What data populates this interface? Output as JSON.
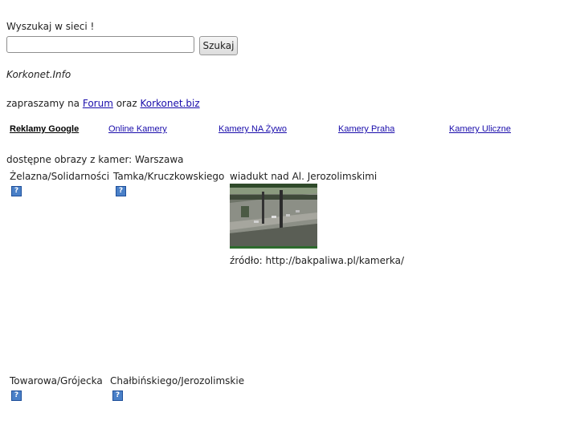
{
  "search": {
    "label": "Wyszukaj w sieci !",
    "input_value": "",
    "button_label": "Szukaj"
  },
  "brand": "Korkonet.Info",
  "invite": {
    "prefix": "zapraszamy na ",
    "forum_link": "Forum",
    "middle": " oraz ",
    "site_link": "Korkonet.biz"
  },
  "ad_links": {
    "header": "Reklamy Google",
    "items": [
      "Online Kamery",
      "Kamery NA Żywo",
      "Kamery Praha",
      "Kamery Uliczne"
    ]
  },
  "cameras": {
    "intro": "dostępne obrazy z kamer: Warszawa",
    "items": [
      {
        "name": "Żelazna/Solidarności"
      },
      {
        "name": "Tamka/Kruczkowskiego"
      },
      {
        "name": "wiadukt nad Al. Jerozolimskimi",
        "source": "źródło: http://bakpaliwa.pl/kamerka/"
      },
      {
        "name": "Towarowa/Grójecka"
      },
      {
        "name": "Chałbińskiego/Jerozolimskie"
      }
    ]
  },
  "icons": {
    "broken_image": "broken-image-icon",
    "broken_image_glyph": "?"
  }
}
